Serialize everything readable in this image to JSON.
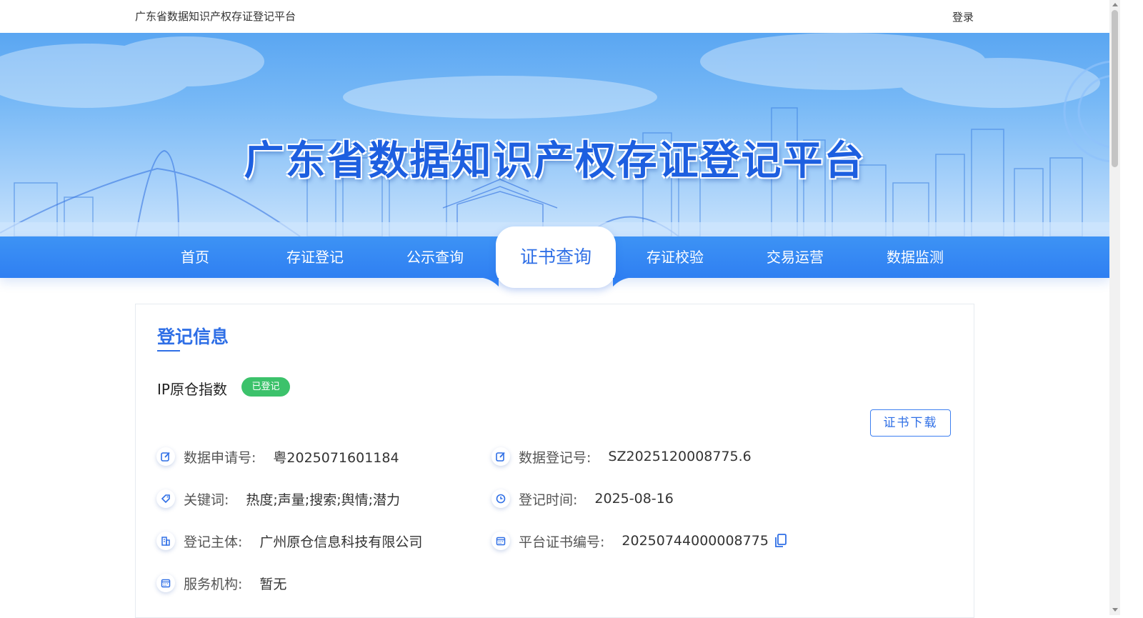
{
  "header": {
    "site_name": "广东省数据知识产权存证登记平台",
    "login_label": "登录"
  },
  "banner": {
    "title": "广东省数据知识产权存证登记平台"
  },
  "nav": {
    "items": [
      {
        "label": "首页"
      },
      {
        "label": "存证登记"
      },
      {
        "label": "公示查询"
      },
      {
        "label": "证书查询",
        "active": true
      },
      {
        "label": "存证校验"
      },
      {
        "label": "交易运营"
      },
      {
        "label": "数据监测"
      }
    ]
  },
  "section": {
    "title": "登记信息",
    "entry_name": "IP原仓指数",
    "status_badge": "已登记",
    "download_button": "证书下载",
    "fields": {
      "application_no": {
        "label": "数据申请号:",
        "value": "粤2025071601184",
        "icon": "edit-icon"
      },
      "registration_no": {
        "label": "数据登记号:",
        "value": "SZ2025120008775.6",
        "icon": "edit-icon"
      },
      "keywords": {
        "label": "关键词:",
        "value": "热度;声量;搜索;舆情;潜力",
        "icon": "tag-icon"
      },
      "registration_time": {
        "label": "登记时间:",
        "value": "2025-08-16",
        "icon": "clock-icon"
      },
      "registrant": {
        "label": "登记主体:",
        "value": "广州原仓信息科技有限公司",
        "icon": "building-icon"
      },
      "certificate_no": {
        "label": "平台证书编号:",
        "value": "20250744000008775",
        "icon": "calendar-icon"
      },
      "service_org": {
        "label": "服务机构:",
        "value": "暂无",
        "icon": "calendar-icon"
      }
    }
  },
  "colors": {
    "primary": "#2f6fe6",
    "nav_bg": "#3388f4",
    "badge": "#3cc26b"
  }
}
